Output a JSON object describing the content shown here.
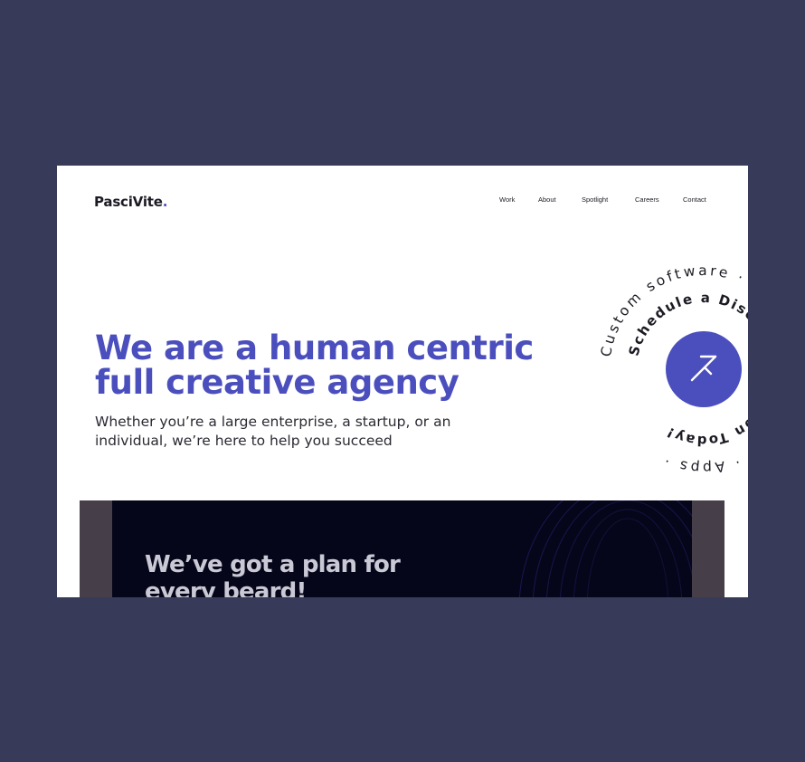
{
  "brand": {
    "name": "PasciVite",
    "dot": ".",
    "accent": "#4b4fbd"
  },
  "nav": {
    "items": [
      "Work",
      "About",
      "Spotlight",
      "Careers",
      "Contact"
    ]
  },
  "hero": {
    "title_line1": "We are a human centric",
    "title_line2": "full creative agency",
    "subtitle_line1": "Whether you’re a large enterprise, a startup, or an",
    "subtitle_line2": "individual, we’re here to help you succeed"
  },
  "badge": {
    "outer_text": "Custom software · Marketing · Websites · Apps ·",
    "inner_text": "Schedule a Discovery Session Today!",
    "icon": "arrow-icon"
  },
  "plan": {
    "title_line1": "We’ve got a plan for",
    "title_line2": "every beard!"
  },
  "colors": {
    "background": "#373a59",
    "panel": "#ffffff",
    "dark_band": "#06061a"
  }
}
